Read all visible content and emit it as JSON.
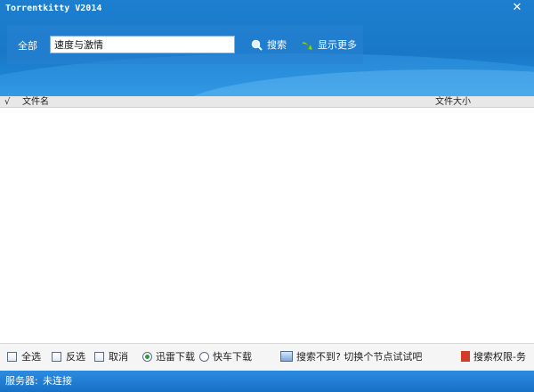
{
  "window": {
    "title": "Torrentkitty V2014"
  },
  "icons": {
    "close": "close-icon",
    "search": "magnifier-icon",
    "more": "green-arrow-icon",
    "switch": "monitor-icon",
    "copyright": "red-flag-icon"
  },
  "colors": {
    "header_blue": "#1978c8",
    "status_blue": "#1670c6",
    "radio_selected": "#2a9c3a"
  },
  "search": {
    "scope_label": "全部",
    "query": "速度与激情",
    "search_label": "搜索",
    "more_label": "显示更多"
  },
  "table": {
    "check_header": "√",
    "columns": [
      "文件名",
      "文件大小"
    ],
    "rows": []
  },
  "options": {
    "select_all": "全选",
    "invert": "反选",
    "cancel": "取消",
    "thunder": "迅雷下载",
    "kuaiche": "快车下载",
    "downloader_selected": "迅雷下载",
    "switch_node": "搜索不到? 切换个节点试试吧",
    "copyright": "搜索权限-务"
  },
  "status": {
    "label": "服务器:",
    "value": "未连接"
  }
}
